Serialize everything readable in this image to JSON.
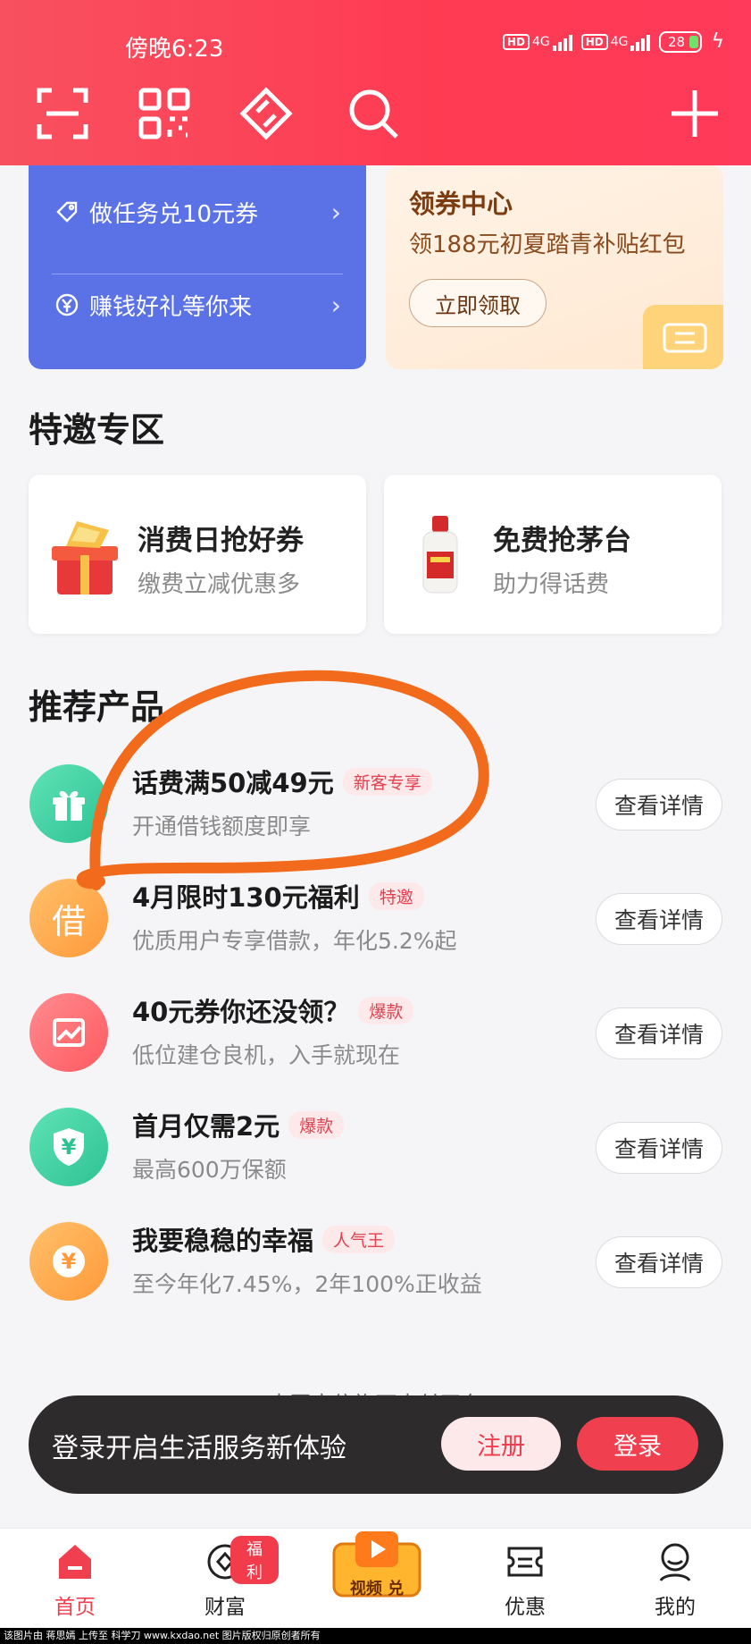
{
  "status_bar": {
    "time": "傍晚6:23",
    "sim1_label": "HD",
    "sim1_net": "4G",
    "sim2_label": "HD",
    "sim2_net": "4G",
    "battery": "28"
  },
  "top_icons": [
    "scan-icon",
    "qr-code-icon",
    "transfer-icon",
    "search-icon",
    "add-icon"
  ],
  "banner_left": {
    "items": [
      {
        "label": "做任务兑10元券",
        "icon": "tag-icon"
      },
      {
        "label": "赚钱好礼等你来",
        "icon": "yuan-coin-icon"
      }
    ]
  },
  "banner_right": {
    "title": "领券中心",
    "subtitle": "领188元初夏踏青补贴红包",
    "button": "立即领取"
  },
  "special_zone": {
    "title": "特邀专区",
    "cards": [
      {
        "title": "消费日抢好券",
        "subtitle": "缴费立减优惠多"
      },
      {
        "title": "免费抢茅台",
        "subtitle": "助力得话费"
      }
    ]
  },
  "products": {
    "title": "推荐产品",
    "items": [
      {
        "title": "话费满50减49元",
        "tag": "新客专享",
        "subtitle": "开通借钱额度即享",
        "button": "查看详情",
        "icon_char": "",
        "color": "#3fd0a0"
      },
      {
        "title": "4月限时130元福利",
        "tag": "特邀",
        "subtitle": "优质用户专享借款，年化5.2%起",
        "button": "查看详情",
        "icon_char": "借",
        "color": "#ffa64a"
      },
      {
        "title": "40元券你还没领？",
        "tag": "爆款",
        "subtitle": "低位建仓良机，入手就现在",
        "button": "查看详情",
        "icon_char": "",
        "color": "#ff6a6f"
      },
      {
        "title": "首月仅需2元",
        "tag": "爆款",
        "subtitle": "最高600万保额",
        "button": "查看详情",
        "icon_char": "¥",
        "color": "#3fd0a0"
      },
      {
        "title": "我要稳稳的幸福",
        "tag": "人气王",
        "subtitle": "至今年化7.45%，2年100%正收益",
        "button": "查看详情",
        "icon_char": "¥",
        "color": "#ffa64a"
      }
    ]
  },
  "footer_note": "中国电信旗下支付平台",
  "login_bar": {
    "text": "登录开启生活服务新体验",
    "register": "注册",
    "login": "登录"
  },
  "bottom_nav": {
    "items": [
      {
        "label": "首页",
        "icon": "home-icon",
        "active": true
      },
      {
        "label": "财富",
        "icon": "wealth-icon",
        "badge": "福利"
      },
      {
        "label": "",
        "icon": "video-exchange-icon"
      },
      {
        "label": "优惠",
        "icon": "coupon-icon"
      },
      {
        "label": "我的",
        "icon": "profile-icon"
      }
    ],
    "video_banner_text": "视频 兑"
  },
  "watermark": "该图片由 蒋思嫣 上传至 科学刀 www.kxdao.net 图片版权归原创者所有",
  "colors": {
    "header_red": "#ff3a52",
    "blue_card": "#5b72e6",
    "accent_red": "#f0404f",
    "annotation_orange": "#f26a1b"
  }
}
